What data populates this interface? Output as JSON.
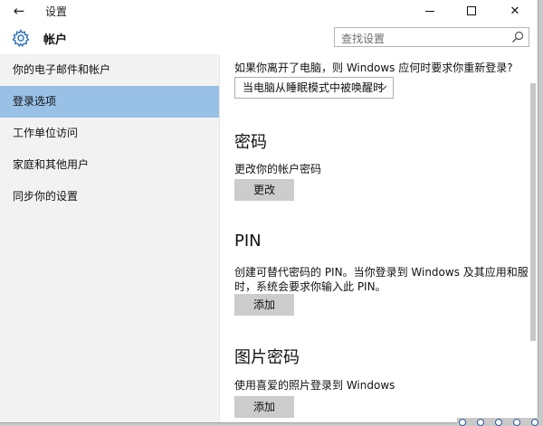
{
  "window": {
    "title": "设置",
    "back_glyph": "←",
    "close_glyph": "✕"
  },
  "header": {
    "app_title": "帐户",
    "search_placeholder": "查找设置"
  },
  "sidebar": {
    "items": [
      {
        "label": "你的电子邮件和帐户",
        "selected": false
      },
      {
        "label": "登录选项",
        "selected": true
      },
      {
        "label": "工作单位访问",
        "selected": false
      },
      {
        "label": "家庭和其他用户",
        "selected": false
      },
      {
        "label": "同步你的设置",
        "selected": false
      }
    ]
  },
  "main": {
    "require_signin": {
      "question": "如果你离开了电脑，则 Windows 应何时要求你重新登录?",
      "selected_option": "当电脑从睡眠模式中被唤醒时"
    },
    "password": {
      "heading": "密码",
      "description": "更改你的帐户密码",
      "button": "更改"
    },
    "pin": {
      "heading": "PIN",
      "description_line1": "创建可替代密码的 PIN。当你登录到 Windows 及其应用和服务",
      "description_line2": "时，系统会要求你输入此 PIN。",
      "button": "添加"
    },
    "picture_password": {
      "heading": "图片密码",
      "description": "使用喜爱的照片登录到 Windows",
      "button": "添加"
    }
  },
  "colors": {
    "selected_nav": "#99c1e6",
    "sidebar_bg": "#f2f2f2",
    "button_bg": "#cccccc",
    "accent_icon": "#2c6fbd"
  }
}
